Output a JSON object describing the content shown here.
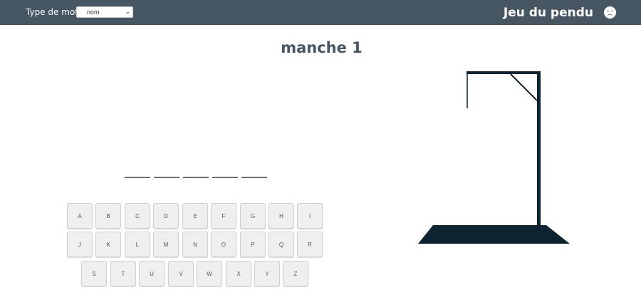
{
  "header": {
    "word_type_label": "Type de mot",
    "word_type_selected": "nom",
    "app_title": "Jeu du pendu"
  },
  "round": {
    "title": "manche 1"
  },
  "word": {
    "slots": [
      "",
      "",
      "",
      "",
      ""
    ]
  },
  "keyboard": {
    "rows": [
      [
        "A",
        "B",
        "C",
        "D",
        "E",
        "F",
        "G",
        "H",
        "I"
      ],
      [
        "J",
        "K",
        "L",
        "M",
        "N",
        "O",
        "P",
        "Q",
        "R"
      ],
      [
        "S",
        "T",
        "U",
        "V",
        "W",
        "X",
        "Y",
        "Z"
      ]
    ]
  },
  "colors": {
    "header_bg": "#465663",
    "title_color": "#465663",
    "gallows_color": "#0e2330"
  }
}
